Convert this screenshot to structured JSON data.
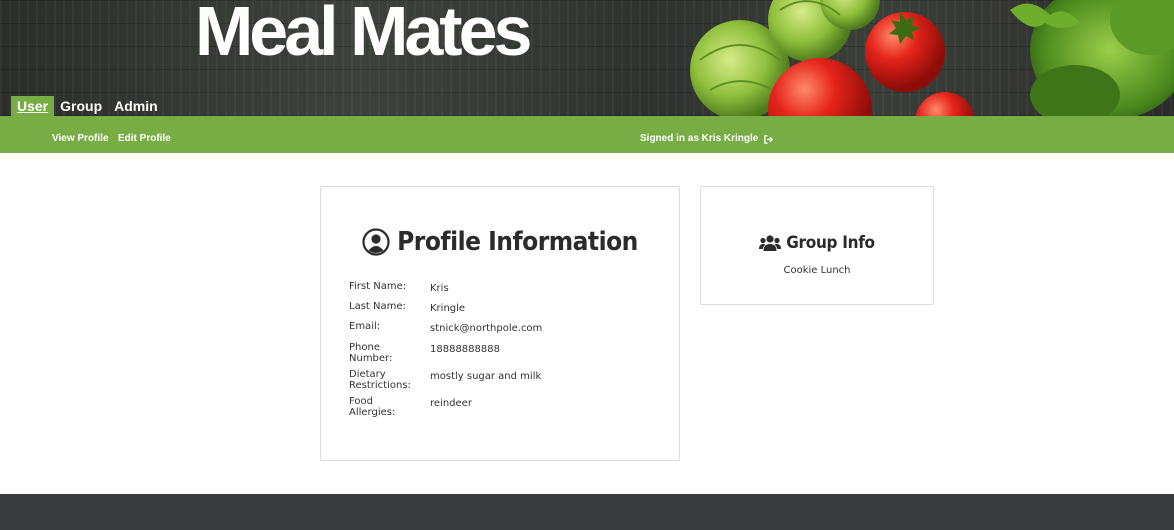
{
  "header": {
    "brand": "Meal Mates",
    "tabs": [
      {
        "label": "User",
        "active": true
      },
      {
        "label": "Group",
        "active": false
      },
      {
        "label": "Admin",
        "active": false
      }
    ],
    "banner_image": "vegetables-brussels-sprouts-tomatoes-lettuce"
  },
  "subnav": {
    "links": [
      "View Profile",
      "Edit Profile"
    ],
    "signed_in_text": "Signed in as Kris Kringle",
    "signout_icon": "sign-out-icon"
  },
  "profile": {
    "title": "Profile Information",
    "title_icon": "user-circle-icon",
    "fields": [
      {
        "label": "First Name:",
        "value": "Kris"
      },
      {
        "label": "Last Name:",
        "value": "Kringle"
      },
      {
        "label": "Email:",
        "value": "stnick@northpole.com"
      },
      {
        "label": "Phone Number:",
        "value": "18888888888"
      },
      {
        "label": "Dietary Restrictions:",
        "value": "mostly sugar and milk"
      },
      {
        "label": "Food Allergies:",
        "value": "reindeer"
      }
    ]
  },
  "group": {
    "title": "Group Info",
    "title_icon": "users-icon",
    "group_name": "Cookie Lunch"
  },
  "colors": {
    "accent_green": "#78ad46",
    "footer": "#3a3b3e",
    "banner_dark": "#333632"
  }
}
